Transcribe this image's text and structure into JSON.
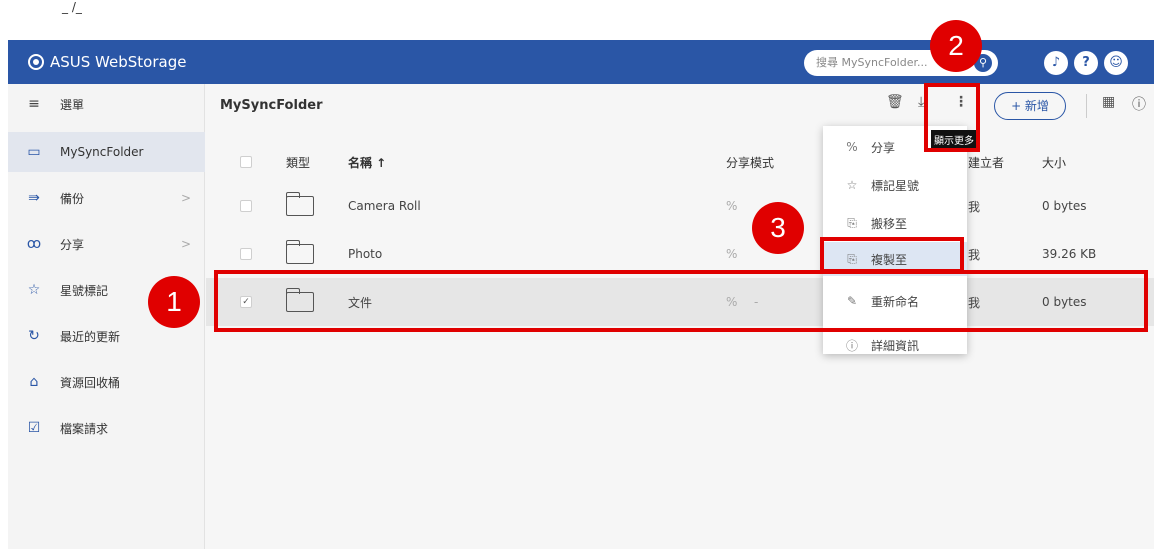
{
  "top_note": "_ /_",
  "header": {
    "brand": "ASUS WebStorage",
    "search_placeholder": "搜尋 MySyncFolder...",
    "search_icon": "search-icon",
    "icons": [
      "bell-icon",
      "help-icon",
      "user-icon"
    ]
  },
  "sidebar": {
    "items": [
      {
        "label": "選單",
        "icon": "menu-icon"
      },
      {
        "label": "MySyncFolder",
        "icon": "monitor-icon"
      },
      {
        "label": "備份",
        "icon": "backup-icon",
        "chevron": ">"
      },
      {
        "label": "分享",
        "icon": "share-icon",
        "chevron": ">"
      },
      {
        "label": "星號標記",
        "icon": "star-icon"
      },
      {
        "label": "最近的更新",
        "icon": "refresh-icon"
      },
      {
        "label": "資源回收桶",
        "icon": "trash-icon"
      },
      {
        "label": "檔案請求",
        "icon": "file-request-icon"
      }
    ]
  },
  "toolbar": {
    "breadcrumb": "MySyncFolder",
    "add_label": "+ 新增",
    "more_tooltip": "顯示更多"
  },
  "table": {
    "columns": {
      "type": "類型",
      "name": "名稱 ↑",
      "share": "分享模式",
      "owner": "建立者",
      "size": "大小"
    },
    "rows": [
      {
        "name": "Camera Roll",
        "share": "",
        "owner": "我",
        "size": "0 bytes",
        "selected": false
      },
      {
        "name": "Photo",
        "share": "",
        "owner": "我",
        "size": "39.26 KB",
        "selected": false
      },
      {
        "name": "文件",
        "share": "-",
        "owner": "我",
        "size": "0 bytes",
        "selected": true
      }
    ]
  },
  "menu": {
    "items": [
      {
        "label": "分享",
        "icon": "link-icon"
      },
      {
        "label": "標記星號",
        "icon": "star-icon"
      },
      {
        "label": "搬移至",
        "icon": "move-icon"
      },
      {
        "label": "複製至",
        "icon": "copy-icon",
        "highlighted": true
      },
      {
        "label": "重新命名",
        "icon": "pencil-icon"
      },
      {
        "label": "詳細資訊",
        "icon": "info-icon"
      }
    ]
  },
  "annotations": {
    "badge1": "1",
    "badge2": "2",
    "badge3": "3",
    "color": "#e00000"
  },
  "colors": {
    "header": "#2a56a6",
    "menu_highlight": "#dde6f3"
  }
}
